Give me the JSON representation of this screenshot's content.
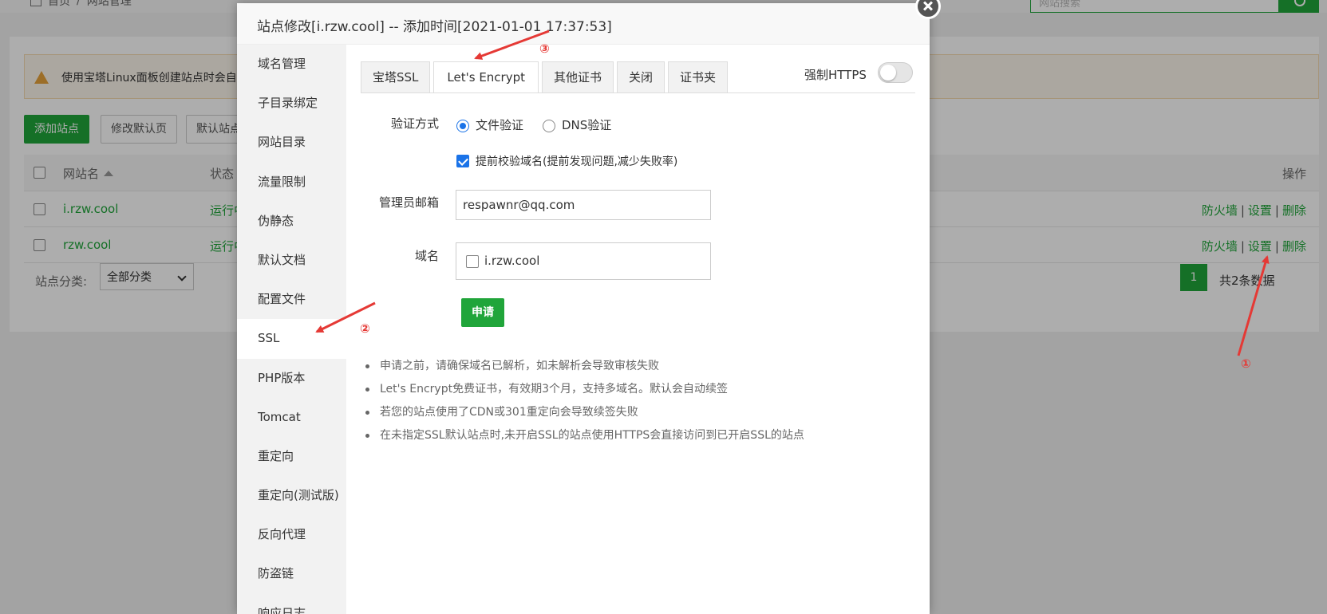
{
  "background": {
    "breadcrumb": {
      "home": "首页",
      "separator": "/",
      "current": "网站管理"
    },
    "search": {
      "placeholder": "网站搜索"
    },
    "alert_text": "使用宝塔Linux面板创建站点时会自",
    "toolbar": {
      "add_site": "添加站点",
      "modify_default": "修改默认页",
      "default_site": "默认站点"
    },
    "table": {
      "headers": {
        "name": "网站名",
        "status": "状态",
        "ops": "操作"
      },
      "rows": [
        {
          "name": "i.rzw.cool",
          "status": "运行中",
          "firewall": "防火墙",
          "settings": "设置",
          "delete": "删除"
        },
        {
          "name": "rzw.cool",
          "status": "运行中",
          "firewall": "防火墙",
          "settings": "设置",
          "delete": "删除"
        }
      ],
      "op_separator": "|"
    },
    "category": {
      "label": "站点分类:",
      "selected": "全部分类"
    },
    "pagination": {
      "current": "1",
      "total": "共2条数据"
    }
  },
  "modal": {
    "title": "站点修改[i.rzw.cool] -- 添加时间[2021-01-01 17:37:53]",
    "side_nav": [
      {
        "label": "域名管理"
      },
      {
        "label": "子目录绑定"
      },
      {
        "label": "网站目录"
      },
      {
        "label": "流量限制"
      },
      {
        "label": "伪静态"
      },
      {
        "label": "默认文档"
      },
      {
        "label": "配置文件"
      },
      {
        "label": "SSL"
      },
      {
        "label": "PHP版本"
      },
      {
        "label": "Tomcat"
      },
      {
        "label": "重定向"
      },
      {
        "label": "重定向(测试版)"
      },
      {
        "label": "反向代理"
      },
      {
        "label": "防盗链"
      },
      {
        "label": "响应日志"
      }
    ],
    "active_nav": "SSL",
    "tabs": [
      {
        "label": "宝塔SSL"
      },
      {
        "label": "Let's Encrypt"
      },
      {
        "label": "其他证书"
      },
      {
        "label": "关闭"
      },
      {
        "label": "证书夹"
      }
    ],
    "active_tab": "Let's Encrypt",
    "force_https": {
      "label": "强制HTTPS",
      "enabled": false
    },
    "form": {
      "verify_label": "验证方式",
      "verify_options": [
        {
          "label": "文件验证",
          "checked": true
        },
        {
          "label": "DNS验证",
          "checked": false
        }
      ],
      "precheck": {
        "label": "提前校验域名(提前发现问题,减少失败率)",
        "checked": true
      },
      "email_label": "管理员邮箱",
      "email_value": "respawnr@qq.com",
      "domain_label": "域名",
      "domains": [
        {
          "name": "i.rzw.cool",
          "checked": false
        }
      ],
      "apply_button": "申请"
    },
    "tips": [
      "申请之前，请确保域名已解析，如未解析会导致审核失败",
      "Let's Encrypt免费证书，有效期3个月，支持多域名。默认会自动续签",
      "若您的站点使用了CDN或301重定向会导致续签失败",
      "在未指定SSL默认站点时,未开启SSL的站点使用HTTPS会直接访问到已开启SSL的站点"
    ]
  },
  "annotations": {
    "step1": "①",
    "step2": "②",
    "step3": "③"
  },
  "colors": {
    "accent": "#20a53a",
    "annotation": "#e53935",
    "checkbox": "#1a73e8"
  }
}
